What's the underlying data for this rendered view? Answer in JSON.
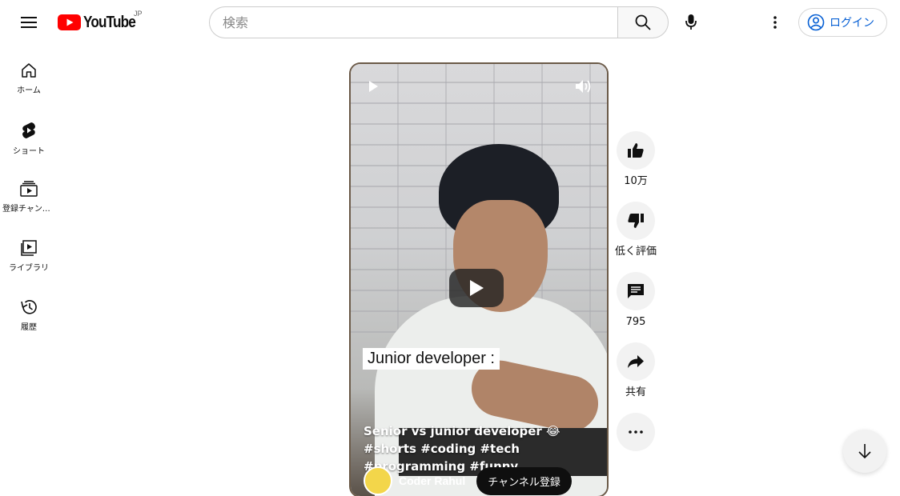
{
  "header": {
    "logo_text": "YouTube",
    "region": "JP",
    "search_placeholder": "検索",
    "login_label": "ログイン"
  },
  "sidebar": {
    "items": [
      {
        "label": "ホーム",
        "icon": "home-icon"
      },
      {
        "label": "ショート",
        "icon": "shorts-icon"
      },
      {
        "label": "登録チャンネル",
        "icon": "subscriptions-icon"
      },
      {
        "label": "ライブラリ",
        "icon": "library-icon"
      },
      {
        "label": "履歴",
        "icon": "history-icon"
      }
    ]
  },
  "video": {
    "caption": "Junior developer :",
    "title": "Senior vs junior developer 😂#shorts #coding #tech #programming #funny",
    "channel": "Coder Rahul",
    "subscribe_label": "チャンネル登録"
  },
  "actions": {
    "like_count": "10万",
    "dislike_label": "低く評価",
    "comment_count": "795",
    "share_label": "共有"
  },
  "colors": {
    "brand_red": "#ff0000",
    "link_blue": "#065fd4"
  }
}
